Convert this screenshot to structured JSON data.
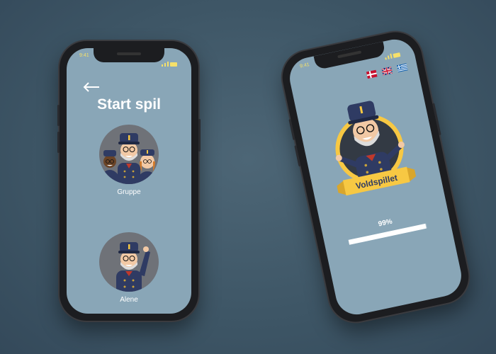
{
  "left_screen": {
    "status_time": "9:41",
    "back_icon": "arrow-left-icon",
    "title": "Start spil",
    "options": [
      {
        "label": "Gruppe",
        "icon": "group-conductors-illustration"
      },
      {
        "label": "Alene",
        "icon": "conductor-saluting-illustration"
      }
    ]
  },
  "right_screen": {
    "status_time": "9:41",
    "languages": [
      "Danish flag",
      "UK flag",
      "Greek flag"
    ],
    "logo_banner": "Voldspillet",
    "progress_label": "99%",
    "progress_value": 0.99
  },
  "colors": {
    "background": "#3d5565",
    "screen": "#89a6b7",
    "accent_yellow": "#f7c843",
    "uniform_navy": "#2f3b63"
  }
}
